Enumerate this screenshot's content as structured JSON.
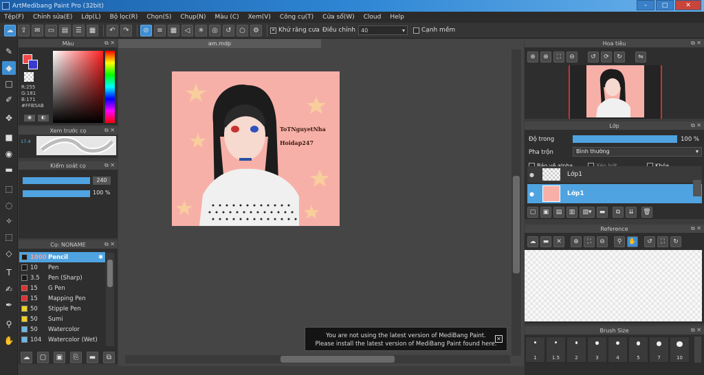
{
  "window": {
    "title": "ArtMedibang Paint Pro (32bit)",
    "minimize": "–",
    "maximize": "□",
    "close": "✕"
  },
  "menu": [
    "Tệp(F)",
    "Chỉnh sửa(E)",
    "Lớp(L)",
    "Bộ lọc(R)",
    "Chọn(S)",
    "Chụp(N)",
    "Màu (C)",
    "Xem(V)",
    "Công cụ(T)",
    "Cửa sổ(W)",
    "Cloud",
    "Help"
  ],
  "toolbar": {
    "antialias_label": "Khử răng cưa",
    "antialias_checked": "✕",
    "correction_label": "Điều chỉnh",
    "correction_value": "40",
    "smooth_edge_label": "Cạnh mềm"
  },
  "color_panel": {
    "title": "Màu",
    "r": "R:255",
    "g": "G:181",
    "b": "B:171",
    "hex": "#FFB5AB",
    "primary": "#f04848",
    "secondary": "#3a3ad0"
  },
  "brush_preview": {
    "title": "Xem trước cọ",
    "size": "17.4"
  },
  "brush_control": {
    "title": "Kiểm soát cọ",
    "size_value": "240",
    "opacity_value": "100 %"
  },
  "brush_list": {
    "title": "Cọ: NONAME",
    "items": [
      {
        "size": "1000",
        "name": "Pencil",
        "color": "#1a1a1a",
        "selected": true
      },
      {
        "size": "10",
        "name": "Pen",
        "color": "#1a1a1a"
      },
      {
        "size": "3.5",
        "name": "Pen (Sharp)",
        "color": "#1a1a1a"
      },
      {
        "size": "15",
        "name": "G Pen",
        "color": "#e03030"
      },
      {
        "size": "15",
        "name": "Mapping Pen",
        "color": "#e03030"
      },
      {
        "size": "50",
        "name": "Stipple Pen",
        "color": "#f0d020"
      },
      {
        "size": "50",
        "name": "Sumi",
        "color": "#f0d020"
      },
      {
        "size": "50",
        "name": "Watercolor",
        "color": "#6ab8e8"
      },
      {
        "size": "104",
        "name": "Watercolor (Wet)",
        "color": "#6ab8e8"
      }
    ]
  },
  "canvas": {
    "tab": "am.mdp",
    "text1": "ToTNguyetNha",
    "text2": "Hoidap247",
    "bg": "#f7b0a8"
  },
  "notification": {
    "line1": "You are not using the latest version of MediBang Paint.",
    "line2": "Please install the latest version of MediBang Paint found here.",
    "close": "✕"
  },
  "navigator": {
    "title": "Hoa tiêu"
  },
  "layers": {
    "title": "Lớp",
    "opacity_label": "Độ trong",
    "opacity_value": "100 %",
    "blend_label": "Pha trộn",
    "blend_value": "Bình thường",
    "protect_alpha": "Bảo vệ alpha",
    "clipping": "Xén bớt",
    "lock": "Khóa",
    "items": [
      {
        "name": "Lớp1"
      },
      {
        "name": "Lớp1",
        "selected": true
      }
    ]
  },
  "reference": {
    "title": "Reference"
  },
  "brush_size": {
    "title": "Brush Size",
    "sizes": [
      "1",
      "1.5",
      "2",
      "3",
      "4",
      "5",
      "7",
      "10"
    ]
  }
}
